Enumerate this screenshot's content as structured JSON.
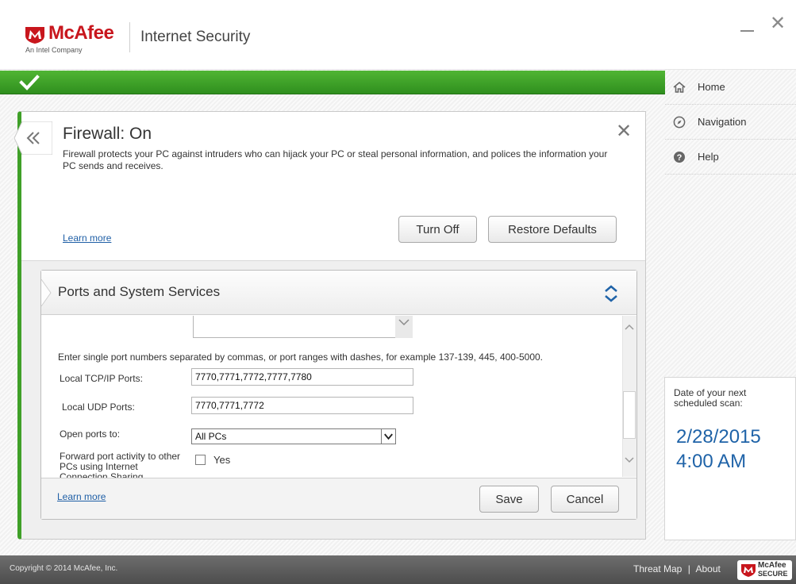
{
  "header": {
    "brand": "McAfee",
    "brand_sub": "An Intel Company",
    "app_title": "Internet Security",
    "minimize_icon": "minimize-icon",
    "close_icon": "close-icon"
  },
  "status": {
    "icon": "checkmark-icon",
    "color": "#3fa028"
  },
  "firewall": {
    "title": "Firewall: On",
    "description": "Firewall protects your PC against intruders who can hijack your PC or steal personal information, and polices the information your PC sends and receives.",
    "learn_more": "Learn more",
    "turn_off_label": "Turn Off",
    "restore_label": "Restore Defaults"
  },
  "ports": {
    "title": "Ports and System Services",
    "instructions": "Enter single port numbers separated by commas, or port ranges with dashes, for example 137-139, 445, 400-5000.",
    "tcp_label": "Local TCP/IP Ports:",
    "tcp_value": "7770,7771,7772,7777,7780",
    "udp_label": "Local UDP Ports:",
    "udp_value": "7770,7771,7772",
    "open_label": "Open ports to:",
    "open_value": "All PCs",
    "forward_label": "Forward port activity to other PCs using Internet Connection Sharing",
    "forward_option": "Yes",
    "learn_more": "Learn more",
    "save_label": "Save",
    "cancel_label": "Cancel"
  },
  "sidebar": {
    "items": [
      {
        "label": "Home",
        "icon": "home-icon"
      },
      {
        "label": "Navigation",
        "icon": "compass-icon"
      },
      {
        "label": "Help",
        "icon": "help-icon"
      }
    ],
    "scan_label": "Date of your next scheduled scan:",
    "scan_date": "2/28/2015",
    "scan_time": "4:00 AM"
  },
  "footer": {
    "copyright": "Copyright © 2014 McAfee, Inc.",
    "threat_map": "Threat Map",
    "separator": "|",
    "about": "About",
    "badge_line1": "McAfee",
    "badge_line2": "SECURE"
  },
  "colors": {
    "accent_green": "#3fa028",
    "brand_red": "#c8161d",
    "link_blue": "#1f5fa6",
    "scan_blue": "#1f63a8"
  }
}
